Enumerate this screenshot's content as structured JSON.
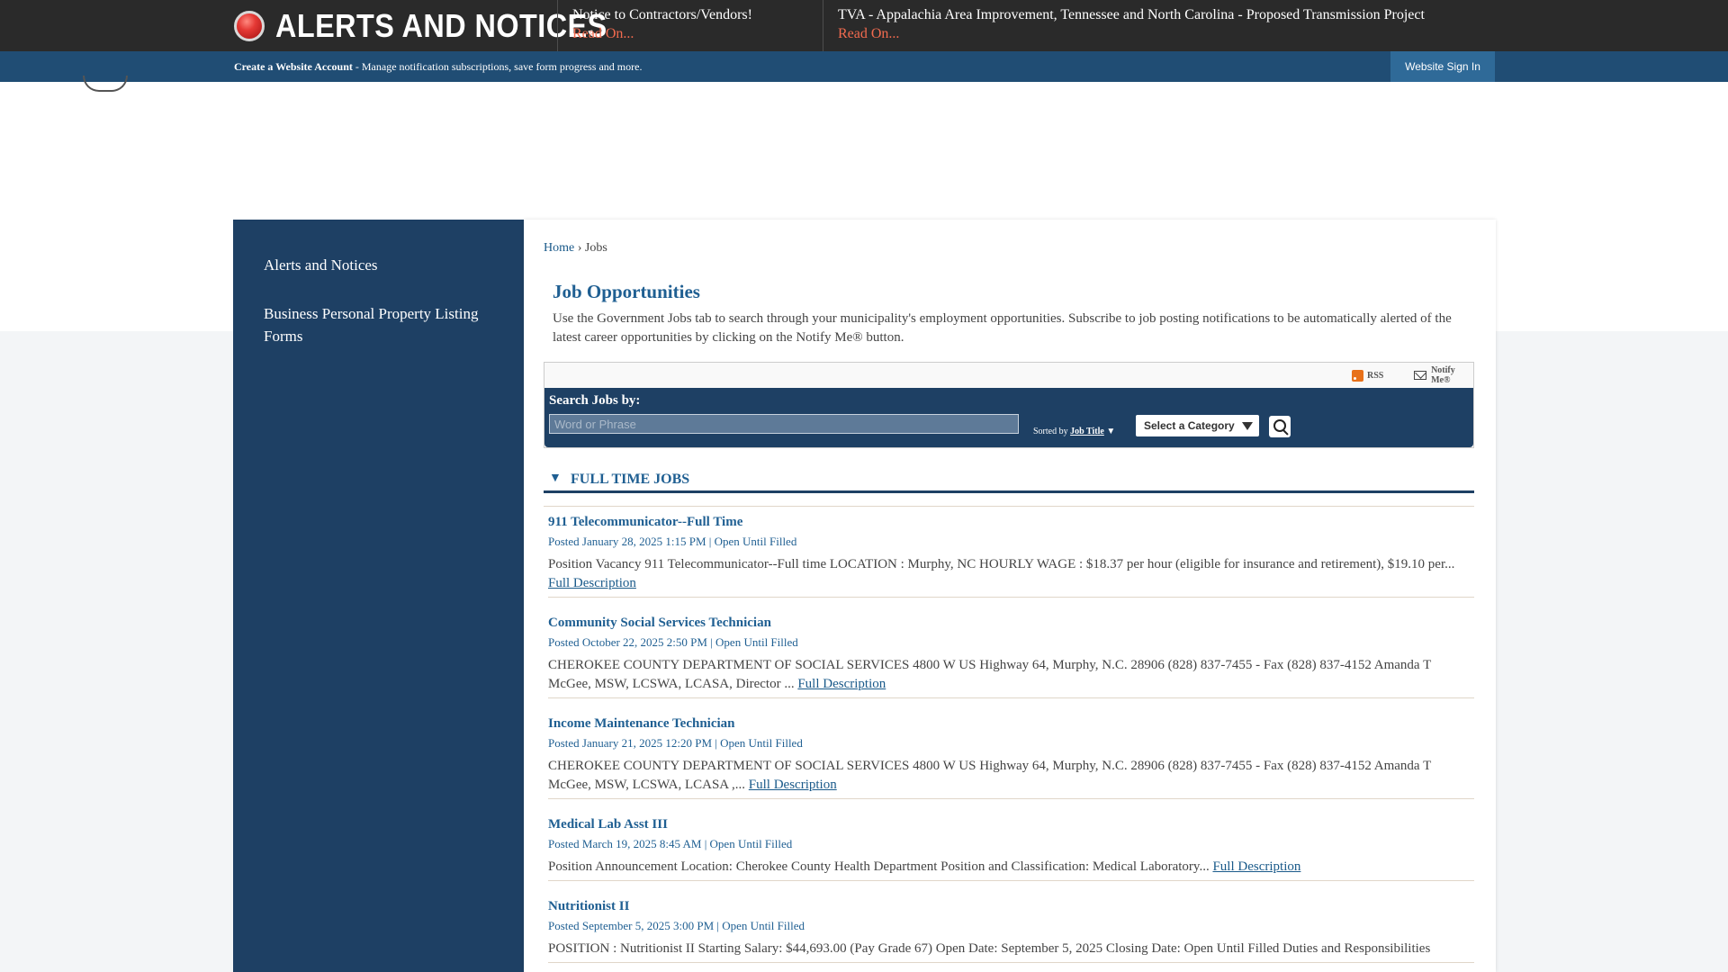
{
  "alerts": {
    "label": "ALERTS AND NOTICES",
    "items": [
      {
        "title": "Notice to Contractors/Vendors!",
        "read_label": "Read On..."
      },
      {
        "title": "TVA - Appalachia Area Improvement, Tennessee and North Carolina - Proposed Transmission Project",
        "read_label": "Read On..."
      }
    ]
  },
  "account_bar": {
    "create_label": "Create a Website Account",
    "create_desc": " - Manage notification subscriptions, save form progress and more.",
    "sign_in_label": "Website Sign In"
  },
  "sidebar": {
    "items": [
      {
        "label": "Alerts and Notices"
      },
      {
        "label": "Business Personal Property Listing Forms"
      }
    ]
  },
  "breadcrumb": {
    "home": "Home",
    "separator": " › ",
    "current": "Jobs"
  },
  "page": {
    "title": "Job Opportunities",
    "intro": "Use the Government Jobs tab to search through your municipality's employment opportunities. Subscribe to job posting notifications to be automatically alerted of the latest career opportunities by clicking on the Notify Me® button."
  },
  "feeds": {
    "rss_label": "RSS",
    "notify_label": "Notify Me®"
  },
  "search": {
    "label": "Search Jobs by:",
    "placeholder": "Word or Phrase",
    "sorted_by_label": "Sorted by ",
    "sort_field": "Job Title",
    "sort_arrow": "▼",
    "category_label": "Select a Category"
  },
  "section": {
    "arrow": "▼",
    "title": "FULL TIME JOBS"
  },
  "jobs": [
    {
      "title": "911 Telecommunicator--Full Time",
      "meta": "Posted January 28, 2025 1:15 PM | Open Until Filled",
      "desc": "Position Vacancy 911 Telecommunicator--Full time LOCATION : Murphy, NC HOURLY WAGE : $18.37 per hour (eligible for insurance and retirement), $19.10 per... ",
      "link": "Full Description"
    },
    {
      "title": "Community Social Services Technician",
      "meta": "Posted October 22, 2025 2:50 PM | Open Until Filled",
      "desc": "CHEROKEE COUNTY DEPARTMENT OF SOCIAL SERVICES 4800 W US Highway 64, Murphy, N.C. 28906 (828) 837-7455 - Fax (828) 837-4152 Amanda T McGee, MSW, LCSWA, LCASA, Director ... ",
      "link": "Full Description"
    },
    {
      "title": "Income Maintenance Technician",
      "meta": "Posted January 21, 2025 12:20 PM | Open Until Filled",
      "desc": "CHEROKEE COUNTY DEPARTMENT OF SOCIAL SERVICES 4800 W US Highway 64, Murphy, N.C. 28906 (828) 837-7455 - Fax (828) 837-4152 Amanda T McGee, MSW, LCSWA, LCASA ,... ",
      "link": "Full Description"
    },
    {
      "title": "Medical Lab Asst III",
      "meta": "Posted March 19, 2025 8:45 AM | Open Until Filled",
      "desc": "Position Announcement Location: Cherokee County Health Department Position and Classification: Medical Laboratory... ",
      "link": "Full Description"
    },
    {
      "title": "Nutritionist II",
      "meta": "Posted September 5, 2025 3:00 PM | Open Until Filled",
      "desc": "POSITION : Nutritionist II Starting Salary: $44,693.00 (Pay Grade 67) Open Date: September 5, 2025 Closing Date: Open Until Filled Duties and Responsibilities",
      "link": ""
    }
  ]
}
